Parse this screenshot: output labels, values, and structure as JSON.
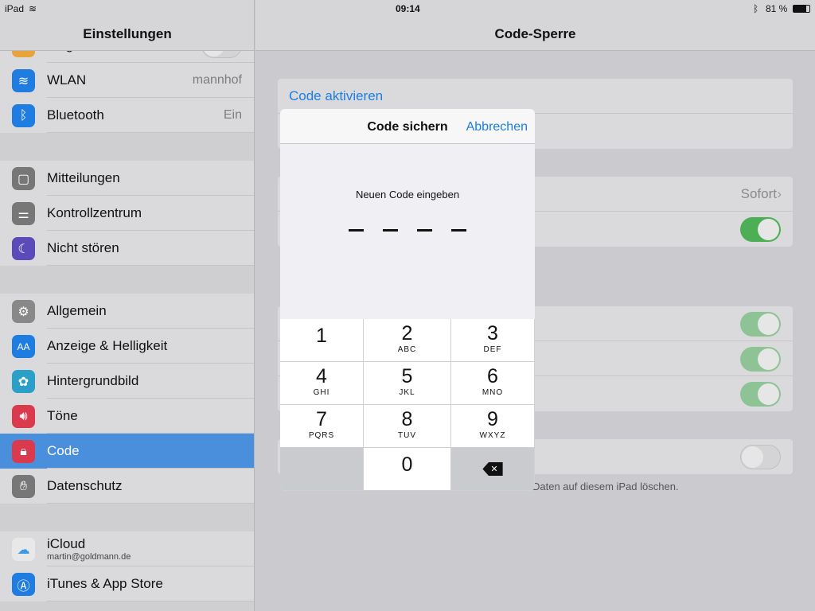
{
  "status": {
    "device": "iPad",
    "time": "09:14",
    "battery": "81 %"
  },
  "sidebar": {
    "title": "Einstellungen",
    "items": [
      {
        "label": "Flugmodus",
        "icon": "airplane-icon",
        "color": "#e8a33a"
      },
      {
        "label": "WLAN",
        "value": "mannhof",
        "icon": "wifi-icon",
        "color": "#1f7ce0"
      },
      {
        "label": "Bluetooth",
        "value": "Ein",
        "icon": "bluetooth-icon",
        "color": "#1f7ce0"
      },
      {
        "label": "Mitteilungen",
        "icon": "notifications-icon",
        "color": "#777"
      },
      {
        "label": "Kontrollzentrum",
        "icon": "control-center-icon",
        "color": "#777"
      },
      {
        "label": "Nicht stören",
        "icon": "moon-icon",
        "color": "#5a4bb8"
      },
      {
        "label": "Allgemein",
        "icon": "gear-icon",
        "color": "#888"
      },
      {
        "label": "Anzeige & Helligkeit",
        "icon": "display-icon",
        "color": "#1f7ce0"
      },
      {
        "label": "Hintergrundbild",
        "icon": "wallpaper-icon",
        "color": "#2aa0c8"
      },
      {
        "label": "Töne",
        "icon": "sound-icon",
        "color": "#d93a4e"
      },
      {
        "label": "Code",
        "icon": "lock-icon",
        "color": "#d93a4e"
      },
      {
        "label": "Datenschutz",
        "icon": "hand-icon",
        "color": "#777"
      },
      {
        "label": "iCloud",
        "sub": "martin@goldmann.de",
        "icon": "cloud-icon",
        "color": "#e8e8e8"
      },
      {
        "label": "iTunes & App Store",
        "icon": "app-store-icon",
        "color": "#1f7ce0"
      }
    ]
  },
  "main": {
    "title": "Code-Sperre",
    "code_activate": "Code aktivieren",
    "require_value": "Sofort",
    "footer": "Daten auf diesem iPad löschen."
  },
  "modal": {
    "title": "Code sichern",
    "cancel": "Abbrechen",
    "prompt": "Neuen Code eingeben",
    "keys": [
      {
        "n": "1",
        "l": ""
      },
      {
        "n": "2",
        "l": "ABC"
      },
      {
        "n": "3",
        "l": "DEF"
      },
      {
        "n": "4",
        "l": "GHI"
      },
      {
        "n": "5",
        "l": "JKL"
      },
      {
        "n": "6",
        "l": "MNO"
      },
      {
        "n": "7",
        "l": "PQRS"
      },
      {
        "n": "8",
        "l": "TUV"
      },
      {
        "n": "9",
        "l": "WXYZ"
      },
      {
        "n": "0",
        "l": ""
      }
    ]
  }
}
